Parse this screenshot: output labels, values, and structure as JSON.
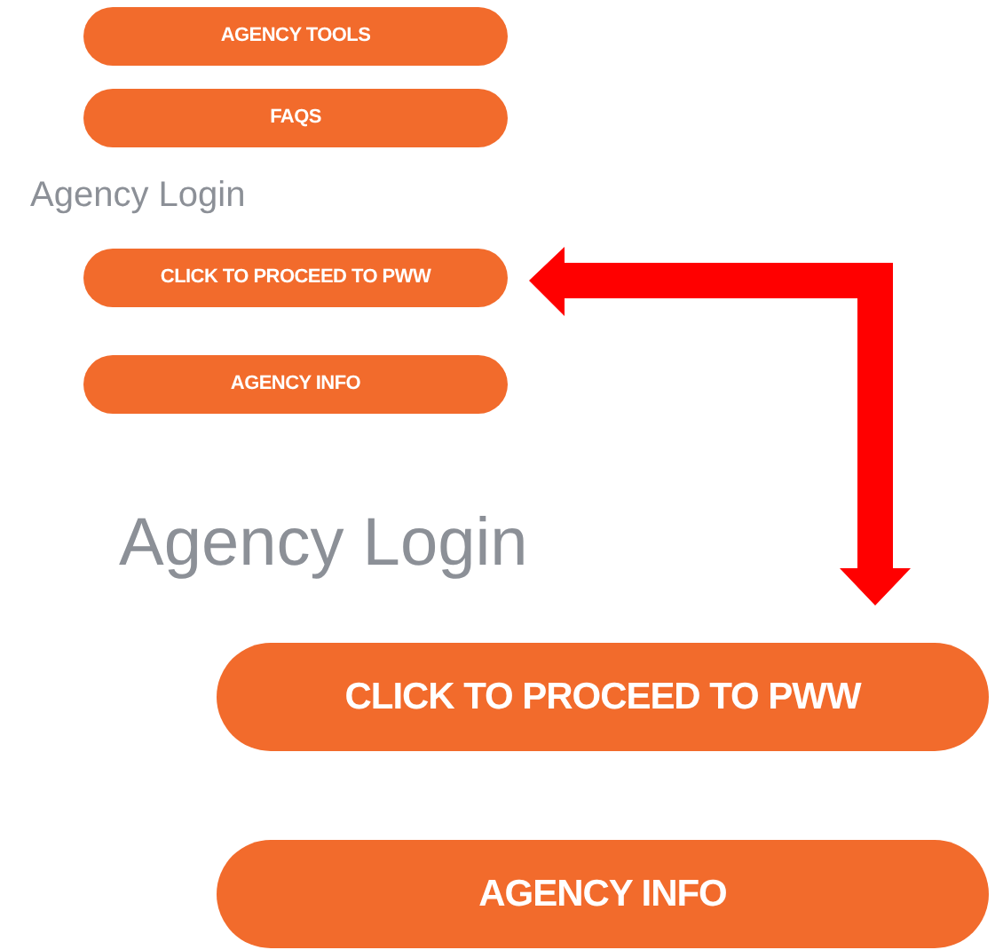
{
  "menu": {
    "buttons": [
      {
        "label": "AGENCY TOOLS"
      },
      {
        "label": "FAQS"
      }
    ],
    "heading": "Agency Login",
    "login_buttons": [
      {
        "label": "CLICK TO PROCEED TO PWW"
      },
      {
        "label": "AGENCY INFO"
      }
    ]
  },
  "zoomed": {
    "heading": "Agency Login",
    "buttons": [
      {
        "label": "CLICK TO PROCEED TO PWW"
      },
      {
        "label": "AGENCY INFO"
      }
    ]
  }
}
